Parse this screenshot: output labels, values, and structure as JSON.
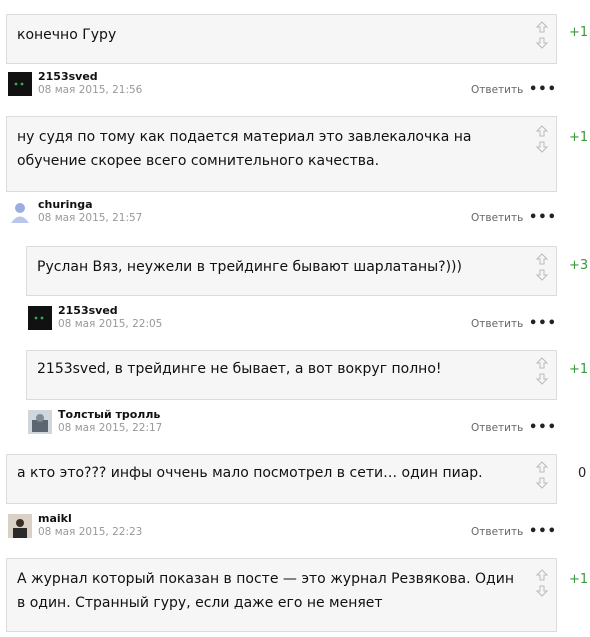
{
  "comments": [
    {
      "text": "конечно Гуру",
      "score": "+1"
    },
    {
      "author": "2153sved",
      "date": "08 мая 2015, 21:56",
      "reply": "Ответить",
      "text": "ну судя по тому как подается материал это завлекалочка на обучение скорее всего сомнительного качества.",
      "score": "+1"
    },
    {
      "author": "churinga",
      "date": "08 мая 2015, 21:57",
      "reply": "Ответить",
      "text": "Руслан Вяз, неужели в трейдинге бывают шарлатаны?)))",
      "score": "+3"
    },
    {
      "author": "2153sved",
      "date": "08 мая 2015, 22:05",
      "reply": "Ответить",
      "text": "2153sved, в трейдинге не бывает, а вот вокруг полно!",
      "score": "+1"
    },
    {
      "author": "Толстый тролль",
      "date": "08 мая 2015, 22:17",
      "reply": "Ответить",
      "text": "а кто это??? инфы оччень мало посмотрел в сети… один пиар.",
      "score": "0"
    },
    {
      "author": "maikl",
      "date": "08 мая 2015, 22:23",
      "reply": "Ответить",
      "text": "А журнал который показан в посте — это журнал Резвякова. Один в один. Странный гуру, если даже его не меняет",
      "score": "+1"
    }
  ],
  "more_label": "•••",
  "colors": {
    "score_positive": "#3a9a3a",
    "bubble_bg": "#f6f6f6",
    "bubble_border": "#dcdcdc"
  }
}
